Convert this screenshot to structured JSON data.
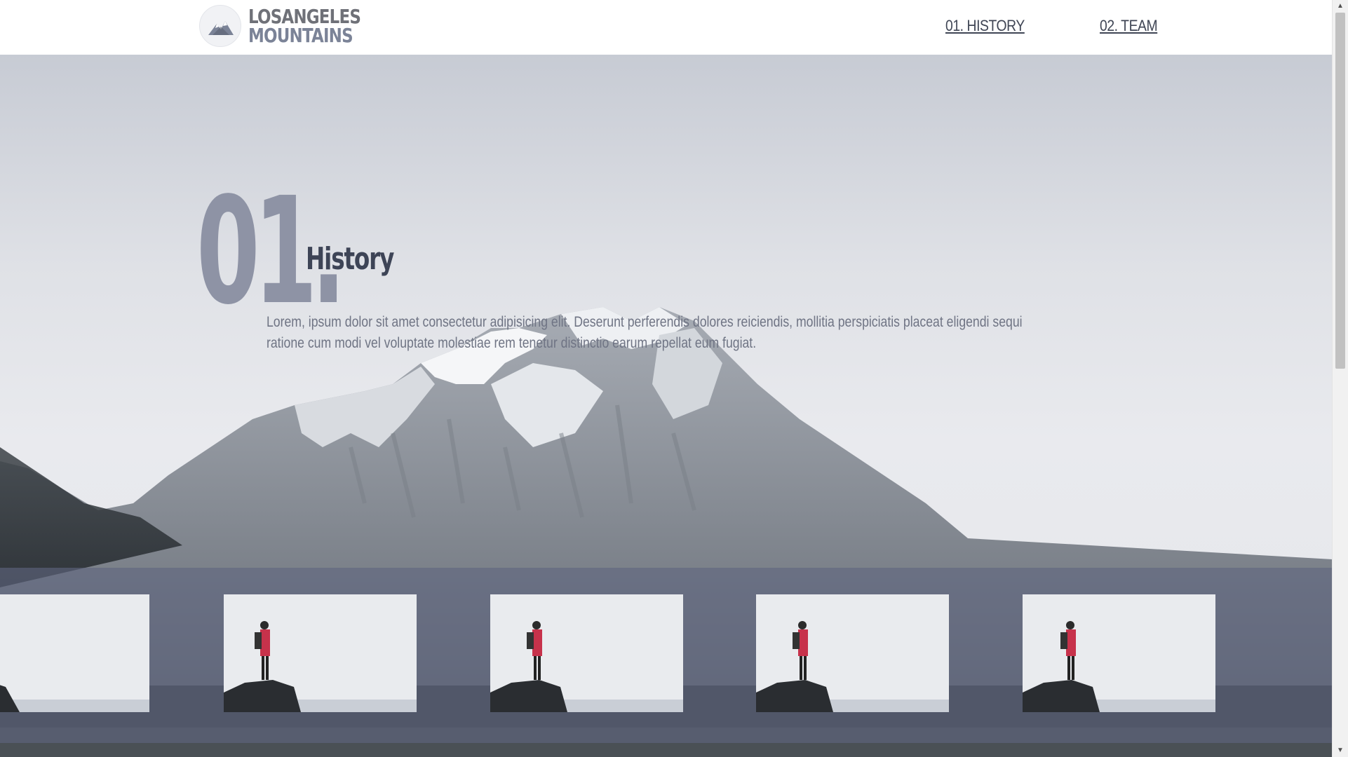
{
  "brand": {
    "line1": "LOSANGELES",
    "line2": "MOUNTAINS",
    "logo_icon": "mountain-badge-icon"
  },
  "nav": {
    "items": [
      {
        "label": "01. HISTORY"
      },
      {
        "label": "02. TEAM"
      }
    ]
  },
  "section": {
    "number": "01.",
    "title": "History",
    "text": "Lorem, ipsum dolor sit amet consectetur adipisicing elit. Deserunt perferendis dolores reiciendis, mollitia perspiciatis placeat eligendi sequi ratione cum modi vel voluptate molestiae rem tenetur distinctio earum repellat eum fugiat."
  },
  "gallery": {
    "image_subject": "hiker-on-rock-photo",
    "count": 5
  },
  "colors": {
    "accent": "#8e93a5",
    "title": "#3d4456",
    "text": "#6f7484",
    "strip": "#5f6680"
  }
}
